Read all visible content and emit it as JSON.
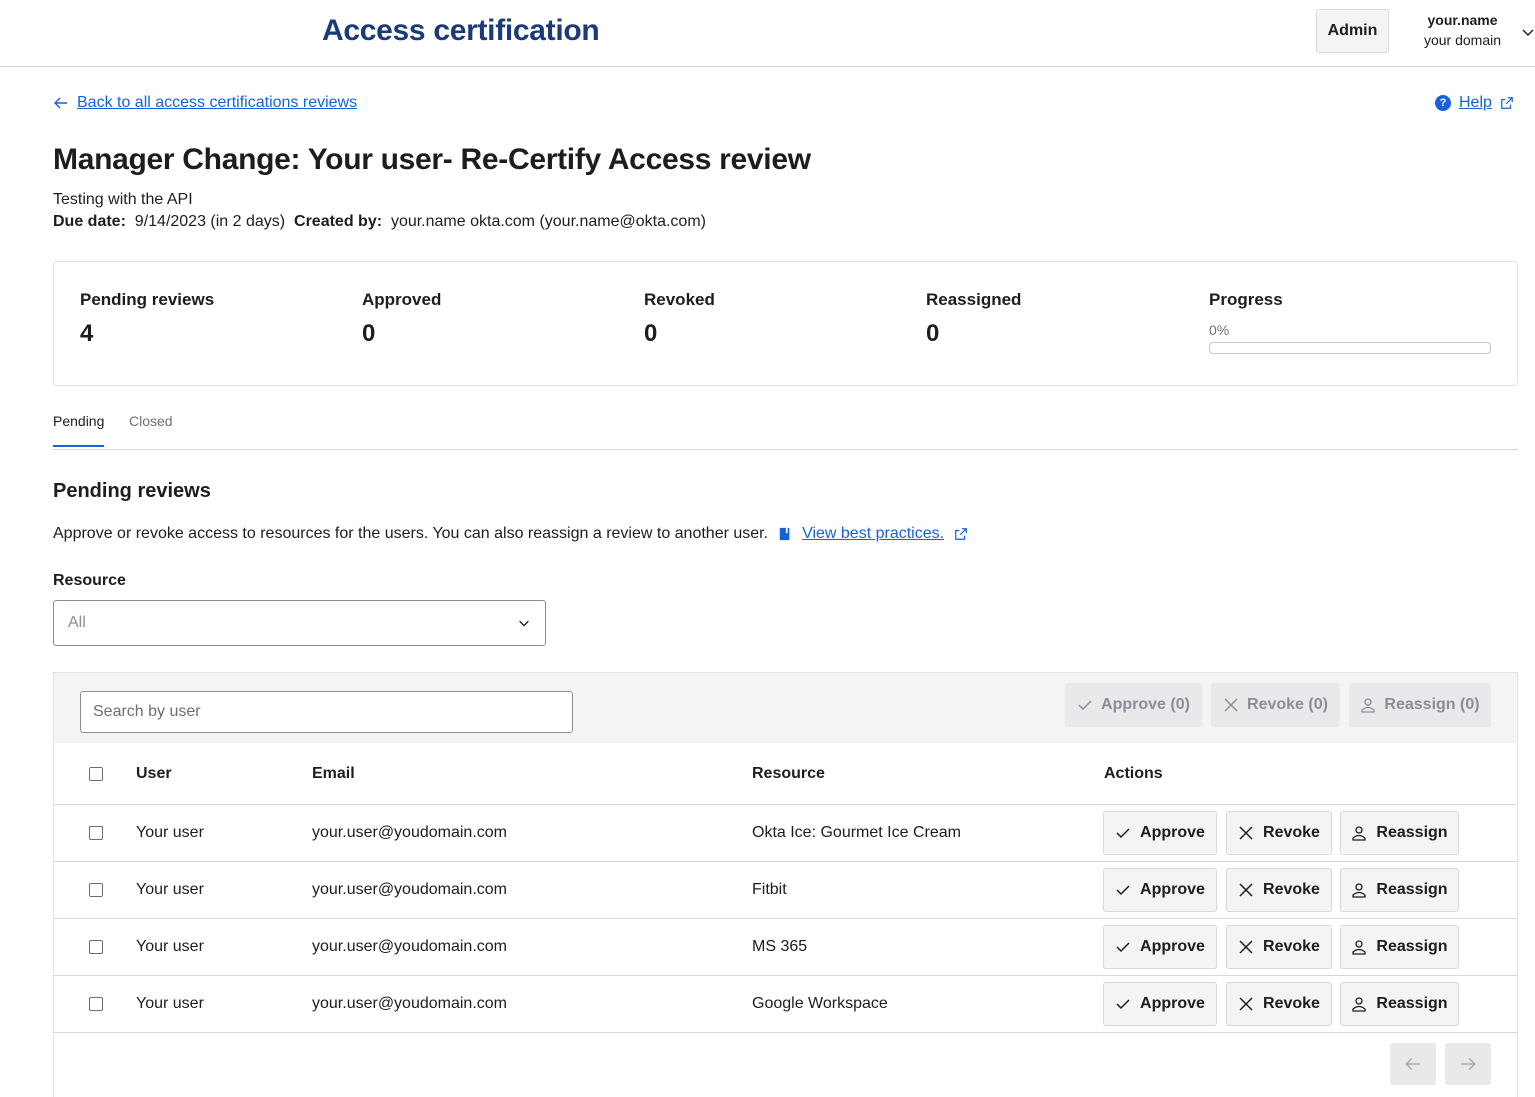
{
  "header": {
    "app_title": "Access certification",
    "admin_label": "Admin",
    "user_name": "your.name",
    "user_domain": "your domain"
  },
  "nav": {
    "back_label": "Back to all access certifications reviews",
    "help_label": "Help"
  },
  "campaign": {
    "title": "Manager Change: Your user- Re-Certify Access review",
    "description": "Testing with the API",
    "due_label": "Due date:",
    "due_value": "9/14/2023 (in 2 days)",
    "created_label": "Created by:",
    "created_value": "your.name okta.com (your.name@okta.com)"
  },
  "stats": {
    "pending_label": "Pending reviews",
    "pending_value": "4",
    "approved_label": "Approved",
    "approved_value": "0",
    "revoked_label": "Revoked",
    "revoked_value": "0",
    "reassigned_label": "Reassigned",
    "reassigned_value": "0",
    "progress_label": "Progress",
    "progress_text": "0%",
    "progress_fraction": 0
  },
  "tabs": [
    {
      "label": "Pending",
      "active": true
    },
    {
      "label": "Closed",
      "active": false
    }
  ],
  "pending": {
    "title": "Pending reviews",
    "description": "Approve or revoke access to resources for the users. You can also reassign a review to another user.",
    "best_practices_link": "View best practices.",
    "resource_label": "Resource",
    "resource_value": "All"
  },
  "toolbar": {
    "search_placeholder": "Search by user",
    "approve_bulk": "Approve (0)",
    "revoke_bulk": "Revoke (0)",
    "reassign_bulk": "Reassign (0)"
  },
  "table": {
    "columns": [
      "User",
      "Email",
      "Resource",
      "Actions"
    ],
    "action_labels": {
      "approve": "Approve",
      "revoke": "Revoke",
      "reassign": "Reassign"
    },
    "rows": [
      {
        "user": "Your user",
        "email": "your.user@youdomain.com",
        "resource": "Okta Ice: Gourmet Ice Cream"
      },
      {
        "user": "Your user",
        "email": "your.user@youdomain.com",
        "resource": "Fitbit"
      },
      {
        "user": "Your user",
        "email": "your.user@youdomain.com",
        "resource": "MS 365"
      },
      {
        "user": "Your user",
        "email": "your.user@youdomain.com",
        "resource": "Google Workspace"
      }
    ]
  },
  "colors": {
    "brand_title": "#1a3a7a",
    "link": "#1662dd",
    "disabled_text": "#8c8c96"
  },
  "icons": {
    "back": "arrow-left-icon",
    "help": "help-circle-icon",
    "external": "external-link-icon",
    "book": "book-icon",
    "chevron": "chevron-down-icon",
    "approve": "check-icon",
    "revoke": "x-icon",
    "reassign": "user-icon",
    "prev": "arrow-left-icon",
    "next": "arrow-right-icon"
  }
}
